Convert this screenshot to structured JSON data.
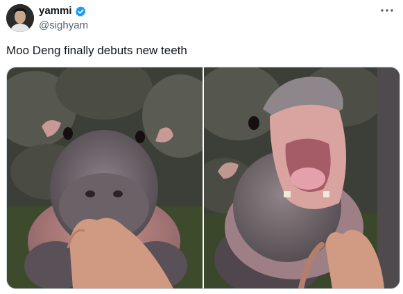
{
  "author": {
    "display_name": "yammi",
    "handle": "@sighyam",
    "verified": true,
    "avatar_icon": "user-avatar"
  },
  "more_icon": "more-horizontal-icon",
  "tweet": {
    "text": "Moo Deng finally debuts new teeth"
  },
  "media": {
    "photos": [
      {
        "icon": "baby-hippo-photo"
      },
      {
        "icon": "baby-hippo-open-mouth-photo"
      }
    ]
  },
  "colors": {
    "verified_badge": "#1d9bf0",
    "secondary_text": "#536471",
    "border": "#cfd9de"
  }
}
